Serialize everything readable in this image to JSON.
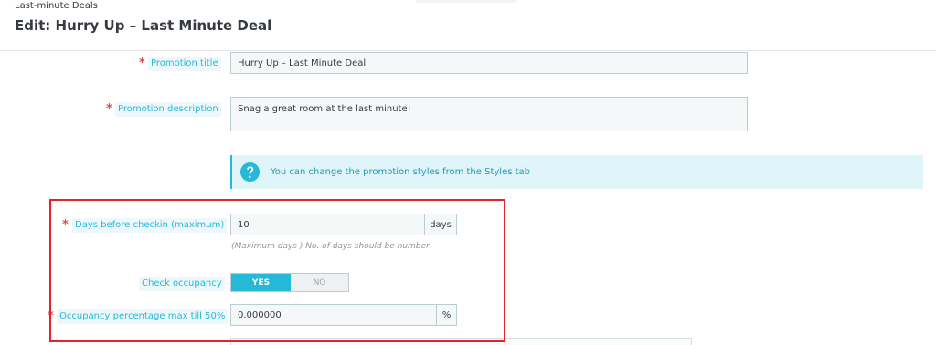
{
  "header": {
    "breadcrumb": "Last-minute Deals",
    "title": "Edit: Hurry Up – Last Minute Deal"
  },
  "form": {
    "promotion_title": {
      "label": "Promotion title",
      "required_mark": "*",
      "value": "Hurry Up – Last Minute Deal"
    },
    "promotion_description": {
      "label": "Promotion description",
      "required_mark": "*",
      "value": "Snag a great room at the last minute!"
    },
    "info": {
      "icon": "question-circle-icon",
      "text": "You can change the promotion styles from the",
      "link_text": "Styles tab"
    },
    "days_before_checkin": {
      "label": "Days before checkin (maximum)",
      "required_mark": "*",
      "value": "10",
      "unit": "days",
      "hint": "(Maximum days ) No. of days should be number"
    },
    "check_occupancy": {
      "label": "Check occupancy",
      "yes_label": "YES",
      "no_label": "NO",
      "selected": "YES"
    },
    "occupancy_percentage": {
      "label": "Occupancy percentage max till 50%",
      "required_mark": "*",
      "value": "0.000000",
      "unit": "%"
    }
  },
  "colors": {
    "accent": "#25b9d7",
    "required": "#e04b4b",
    "highlight_border": "#e4222a",
    "info_bg": "#dff5f9"
  }
}
